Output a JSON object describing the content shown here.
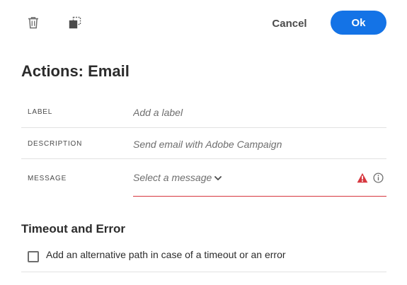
{
  "toolbar": {
    "delete_icon": "trash-icon",
    "duplicate_icon": "duplicate-icon",
    "cancel_label": "Cancel",
    "ok_label": "Ok"
  },
  "page": {
    "title": "Actions: Email"
  },
  "fields": {
    "label": {
      "name": "LABEL",
      "placeholder": "Add a label",
      "value": ""
    },
    "description": {
      "name": "DESCRIPTION",
      "placeholder": "Send email with Adobe Campaign",
      "value": ""
    },
    "message": {
      "name": "MESSAGE",
      "placeholder": "Select a message",
      "status_icon": "alert-icon",
      "info_icon": "info-icon"
    }
  },
  "timeout": {
    "title": "Timeout and Error",
    "checkbox_label": "Add an alternative path in case of a timeout or an error",
    "checked": false
  },
  "colors": {
    "accent": "#1473e6",
    "error": "#d7373f",
    "divider": "#e1e1e1"
  }
}
